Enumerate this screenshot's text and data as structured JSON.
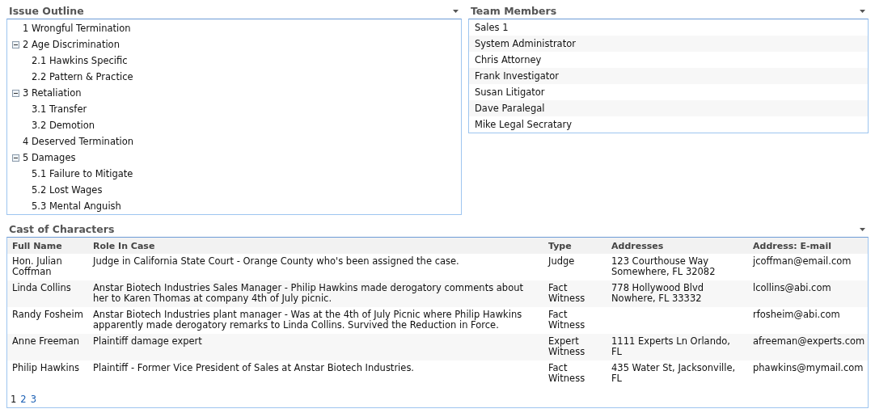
{
  "issue_outline": {
    "title": "Issue Outline",
    "items": [
      {
        "label": "1 Wrongful Termination"
      },
      {
        "label": "2 Age Discrimination",
        "expanded": true,
        "children": [
          {
            "label": "2.1 Hawkins Specific"
          },
          {
            "label": "2.2 Pattern & Practice"
          }
        ]
      },
      {
        "label": "3 Retaliation",
        "expanded": true,
        "children": [
          {
            "label": "3.1 Transfer"
          },
          {
            "label": "3.2 Demotion"
          }
        ]
      },
      {
        "label": "4 Deserved Termination"
      },
      {
        "label": "5 Damages",
        "expanded": true,
        "children": [
          {
            "label": "5.1 Failure to Mitigate"
          },
          {
            "label": "5.2 Lost Wages"
          },
          {
            "label": "5.3 Mental Anguish"
          }
        ]
      }
    ]
  },
  "team_members": {
    "title": "Team Members",
    "items": [
      "Sales 1",
      "System Administrator",
      "Chris Attorney",
      "Frank Investigator",
      "Susan Litigator",
      "Dave Paralegal",
      "Mike Legal Secratary"
    ]
  },
  "cast_of_characters": {
    "title": "Cast of Characters",
    "columns": [
      "Full Name",
      "Role In Case",
      "Type",
      "Addresses",
      "Address: E-mail"
    ],
    "rows": [
      [
        "Hon. Julian Coffman",
        "Judge in California State Court - Orange County who's been assigned the case.",
        "Judge",
        "123 Courthouse Way Somewhere, FL 32082",
        "jcoffman@email.com"
      ],
      [
        "Linda Collins",
        "Anstar Biotech Industries Sales Manager - Philip Hawkins made derogatory comments about her to Karen Thomas at company 4th of July picnic.",
        "Fact Witness",
        "778 Hollywood Blvd Nowhere, FL 33332",
        "lcollins@abi.com"
      ],
      [
        "Randy Fosheim",
        "Anstar Biotech Industries plant manager - Was at the 4th of July Picnic where Philip Hawkins apparently made derogatory remarks to Linda Collins. Survived the Reduction in Force.",
        "Fact Witness",
        "",
        "rfosheim@abi.com"
      ],
      [
        "Anne Freeman",
        "Plaintiff damage expert",
        "Expert Witness",
        "1111 Experts Ln Orlando, FL",
        "afreeman@experts.com"
      ],
      [
        "Philip Hawkins",
        "Plaintiff - Former Vice President of Sales at Anstar Biotech Industries.",
        "Fact Witness",
        "435 Water St, Jacksonville, FL",
        "phawkins@mymail.com"
      ]
    ],
    "pages": [
      {
        "label": "1",
        "selected": true
      },
      {
        "label": "2",
        "selected": false
      },
      {
        "label": "3",
        "selected": false
      }
    ]
  }
}
